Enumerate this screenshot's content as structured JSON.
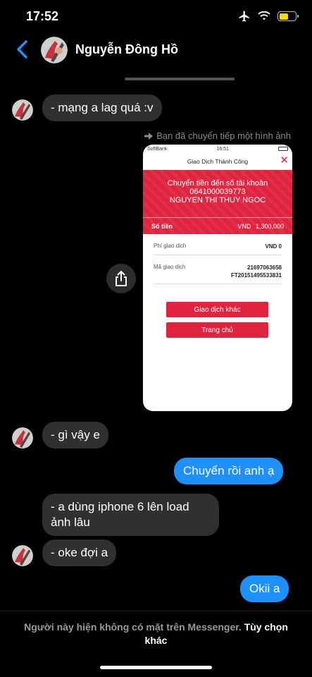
{
  "status_bar": {
    "time": "17:52",
    "icons": [
      "airplane-icon",
      "wifi-icon",
      "battery-icon"
    ],
    "battery_level": 0.55,
    "battery_color": "#f5d90a"
  },
  "header": {
    "contact_name": "Nguyễn Đông Hồ",
    "back_icon": "chevron-left-icon",
    "accent_color": "#1e90ff"
  },
  "messages": [
    {
      "from": "contact",
      "text": "- mạng a lag quá :v"
    },
    {
      "from": "me",
      "forward_note": "Bạn đã chuyển tiếp một hình ảnh"
    },
    {
      "from": "contact",
      "text": "- gì vậy e"
    },
    {
      "from": "me",
      "text": "Chuyển rồi anh ạ"
    },
    {
      "from": "contact",
      "text": "- a dùng iphone 6 lên load ảnh lâu"
    },
    {
      "from": "contact",
      "text": "- oke đợi a"
    },
    {
      "from": "me",
      "text": "Okii a"
    }
  ],
  "shared_image": {
    "status_carrier": "SoftBank",
    "status_time": "16:51",
    "title": "Giao Dịch Thành Công",
    "banner_line1": "Chuyển tiền đến số tài khoản",
    "banner_line2": "0641000039773",
    "banner_line3": "NGUYEN THI THUY NGOC",
    "amount_label": "Số tiền",
    "amount_currency": "VND",
    "amount_value": "1,300,000",
    "fee_label": "Phí giao dịch",
    "fee_value": "VND 0",
    "code_label": "Mã giao dịch",
    "code_value_1": "21697063658",
    "code_value_2": "FT20151495533831",
    "button_other": "Giao dịch khác",
    "button_home": "Trang chủ",
    "brand_color": "#e02440"
  },
  "footer": {
    "note": "Người này hiện không có mặt trên Messenger.",
    "link": "Tùy chọn khác"
  }
}
